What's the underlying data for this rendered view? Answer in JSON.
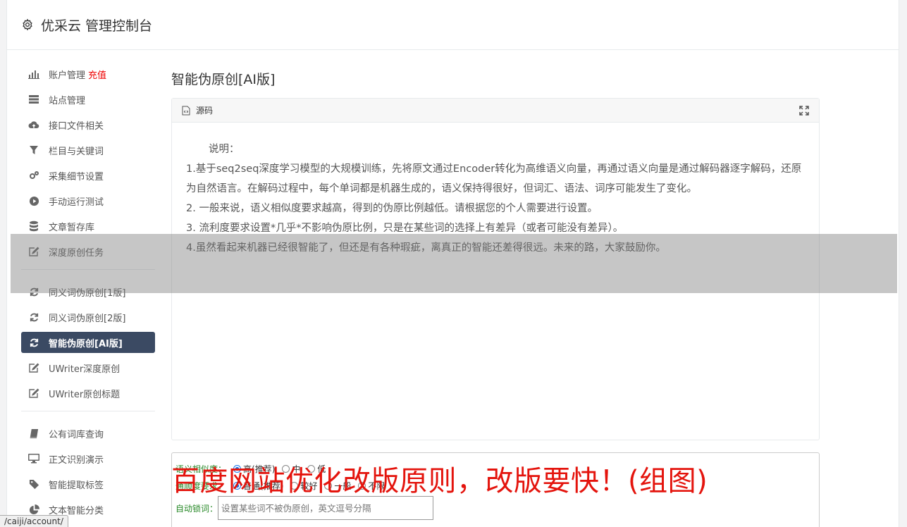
{
  "header": {
    "title": "优采云 管理控制台"
  },
  "sidebar": {
    "group1": [
      {
        "label": "账户管理",
        "extra": "充值",
        "icon": "bar-chart-icon"
      },
      {
        "label": "站点管理",
        "icon": "server-icon"
      },
      {
        "label": "接口文件相关",
        "icon": "cloud-upload-icon"
      },
      {
        "label": "栏目与关键词",
        "icon": "filter-icon"
      },
      {
        "label": "采集细节设置",
        "icon": "gears-icon"
      },
      {
        "label": "手动运行测试",
        "icon": "play-icon"
      },
      {
        "label": "文章暂存库",
        "icon": "database-icon"
      },
      {
        "label": "深度原创任务",
        "icon": "edit-icon"
      }
    ],
    "group2": [
      {
        "label": "同义词伪原创[1版]",
        "icon": "refresh-icon"
      },
      {
        "label": "同义词伪原创[2版]",
        "icon": "refresh-icon"
      },
      {
        "label": "智能伪原创[AI版]",
        "icon": "refresh-icon",
        "active": true
      },
      {
        "label": "UWriter深度原创",
        "icon": "edit-icon"
      },
      {
        "label": "UWriter原创标题",
        "icon": "edit-icon"
      }
    ],
    "group3": [
      {
        "label": "公有词库查询",
        "icon": "book-icon"
      },
      {
        "label": "正文识别演示",
        "icon": "desktop-icon"
      },
      {
        "label": "智能提取标签",
        "icon": "tag-icon"
      },
      {
        "label": "文本智能分类",
        "icon": "pie-chart-icon"
      }
    ]
  },
  "main": {
    "title": "智能伪原创[AI版]",
    "panel_title": "源码",
    "intro": "说明：",
    "lines": [
      "1.基于seq2seq深度学习模型的大规模训练，先将原文通过Encoder转化为高维语义向量，再通过语义向量是通过解码器逐字解码，还原为自然语言。在解码过程中，每个单词都是机器生成的，语义保持得很好，但词汇、语法、词序可能发生了变化。",
      "2. 一般来说，语义相似度要求越高，得到的伪原比例越低。请根据您的个人需要进行设置。",
      "3. 流利度要求设置*几乎*不影响伪原比例，只是在某些词的选择上有差异（或者可能没有差异）。",
      "4.虽然看起来机器已经很智能了，但还是有各种瑕疵，离真正的智能还差得很远。未来的路，大家鼓励你。"
    ]
  },
  "form": {
    "row1_label": "语义相似度：",
    "row1_options": [
      "高(推荐)",
      "中",
      "低"
    ],
    "row2_label": "通顺度要求：",
    "row2_options": [
      "普通(推荐)",
      "较好",
      "一般",
      "不限"
    ],
    "lock_label": "自动锁词：",
    "lock_placeholder": "设置某些词不被伪原创，英文逗号分隔"
  },
  "watermark": "百度网站优化改版原则，改版要快！(组图)",
  "statusbar": "/caiji/account/"
}
